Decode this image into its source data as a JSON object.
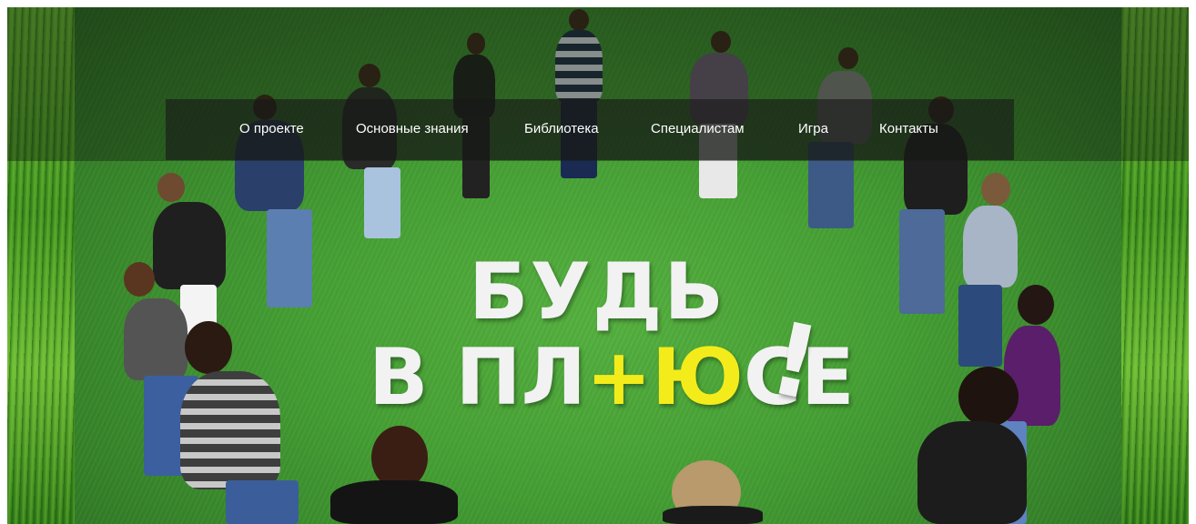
{
  "nav": {
    "items": [
      {
        "label": "О проекте"
      },
      {
        "label": "Основные знания"
      },
      {
        "label": "Библиотека"
      },
      {
        "label": "Специалистам"
      },
      {
        "label": "Игра"
      },
      {
        "label": "Контакты"
      }
    ]
  },
  "hero": {
    "logo": {
      "line1": "БУДЬ",
      "line2_start": "В ПЛ",
      "line2_accent": "+Ю",
      "line2_end": "СЕ",
      "exclaim": "!"
    }
  },
  "colors": {
    "nav_bg": "#191919",
    "logo_text": "#f2f2f2",
    "logo_accent": "#f4ec1a",
    "grass": "#45a034"
  }
}
